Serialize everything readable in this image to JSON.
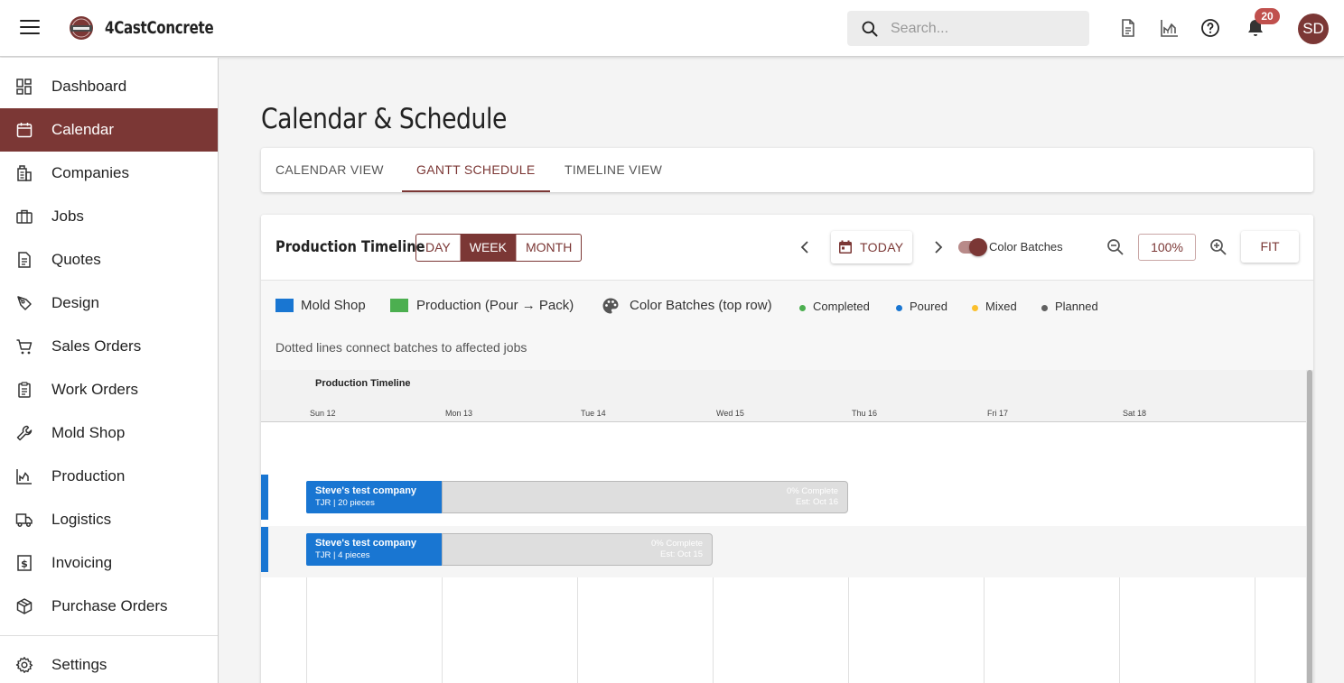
{
  "app": {
    "brand": "4CastConcrete"
  },
  "search": {
    "placeholder": "Search..."
  },
  "header": {
    "notifications_count": "20",
    "user_initials": "SD"
  },
  "sidebar": {
    "items": [
      {
        "label": "Dashboard"
      },
      {
        "label": "Calendar",
        "active": true
      },
      {
        "label": "Companies"
      },
      {
        "label": "Jobs"
      },
      {
        "label": "Quotes"
      },
      {
        "label": "Design"
      },
      {
        "label": "Sales Orders"
      },
      {
        "label": "Work Orders"
      },
      {
        "label": "Mold Shop"
      },
      {
        "label": "Production"
      },
      {
        "label": "Logistics"
      },
      {
        "label": "Invoicing"
      },
      {
        "label": "Purchase Orders"
      }
    ],
    "settings": {
      "label": "Settings"
    }
  },
  "page": {
    "title": "Calendar & Schedule"
  },
  "tabs": [
    {
      "label": "CALENDAR VIEW"
    },
    {
      "label": "GANTT SCHEDULE",
      "active": true
    },
    {
      "label": "TIMELINE VIEW"
    }
  ],
  "gantt": {
    "title": "Production Timeline",
    "views": [
      {
        "label": "DAY"
      },
      {
        "label": "WEEK",
        "active": true
      },
      {
        "label": "MONTH"
      }
    ],
    "today_label": "TODAY",
    "color_batches_label": "Color Batches",
    "color_batches_on": true,
    "zoom": "100%",
    "fit_label": "FIT",
    "legend": {
      "mold_shop": "Mold Shop",
      "production": "Production (Pour → Pack)",
      "color_batches": "Color Batches (top row)",
      "completed": "Completed",
      "poured": "Poured",
      "mixed": "Mixed",
      "planned": "Planned"
    },
    "hint": "Dotted lines connect batches to affected jobs",
    "chart": {
      "title": "Production Timeline",
      "days": [
        "Sun 12",
        "Mon 13",
        "Tue 14",
        "Wed 15",
        "Thu 16",
        "Fri 17",
        "Sat 18"
      ],
      "rows": [
        {
          "company": "Steve's test company",
          "detail": "TJR | 20 pieces",
          "progress": "0% Complete",
          "estimate": "Est: Oct 16",
          "mold_start_day": 0,
          "mold_end_day": 1,
          "prod_end_day": 4
        },
        {
          "company": "Steve's test company",
          "detail": "TJR | 4 pieces",
          "progress": "0% Complete",
          "estimate": "Est: Oct 15",
          "mold_start_day": 0,
          "mold_end_day": 1,
          "prod_end_day": 3
        }
      ]
    }
  },
  "colors": {
    "accent": "#7b3735",
    "mold_shop": "#1976d2",
    "production": "#4caf50",
    "completed": "#4caf50",
    "poured": "#1976d2",
    "mixed": "#fbc02d",
    "planned": "#616161",
    "badge": "#c0504d"
  },
  "icons": {
    "menu": "hamburger-icon",
    "search": "search-icon",
    "document": "document-icon",
    "chart": "chart-icon",
    "help": "help-icon",
    "notifications": "bell-icon",
    "calendar": "calendar-icon",
    "palette": "palette-icon",
    "zoom_out": "zoom-out-icon",
    "zoom_in": "zoom-in-icon"
  }
}
